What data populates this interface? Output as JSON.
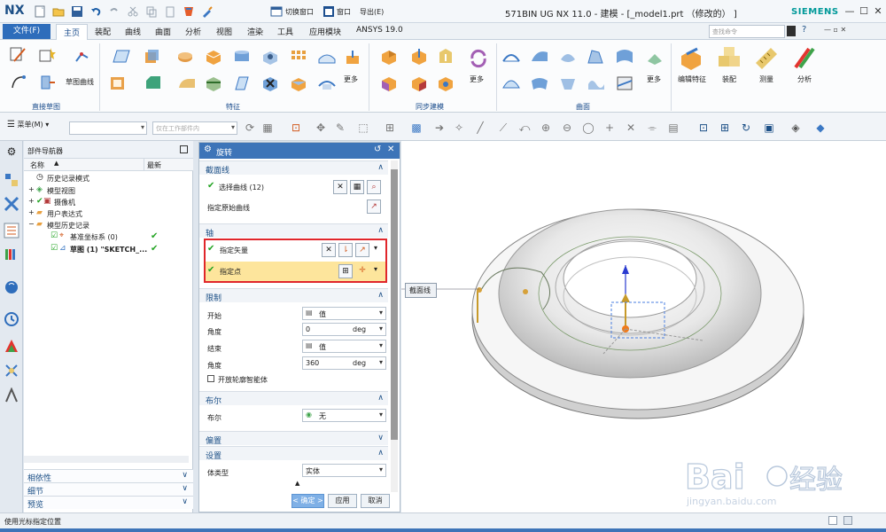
{
  "app": {
    "logo": "NX",
    "title": "571BIN UG NX 11.0 - 建模 - [_model1.prt （修改的） ]",
    "brand": "SIEMENS",
    "window_menu": "窗口",
    "switch_window": "切换窗口",
    "export": "导出(E)",
    "search_placeholder": "查找命令"
  },
  "ribbon": {
    "file_tab": "文件(F)",
    "tabs": [
      "主页",
      "装配",
      "曲线",
      "曲面",
      "分析",
      "视图",
      "渲染",
      "工具",
      "应用模块",
      "ANSYS 19.0"
    ],
    "active_tab": "主页",
    "groups": {
      "direct_sketch": "直接草图",
      "sketch_curve": "草图曲线",
      "feature": "特征",
      "sync_modeling": "同步建模",
      "surface": "曲面",
      "more": "更多",
      "edit_feature": "编辑特征",
      "assembly": "装配",
      "measure": "测量",
      "analysis": "分析"
    }
  },
  "toolbar": {
    "menu": "菜单(M)",
    "filter_placeholder": "",
    "scope": "仅在工作部件内"
  },
  "navigator": {
    "title": "部件导航器",
    "col_name": "名称",
    "col_latest": "最新",
    "items": [
      {
        "label": "历史记录模式",
        "level": 0,
        "check": false
      },
      {
        "label": "模型视图",
        "level": 0,
        "check": false
      },
      {
        "label": "摄像机",
        "level": 0,
        "check": false
      },
      {
        "label": "用户表达式",
        "level": 0,
        "check": false
      },
      {
        "label": "模型历史记录",
        "level": 0,
        "check": false
      },
      {
        "label": "基准坐标系 (0)",
        "level": 1,
        "check": true
      },
      {
        "label": "草图 (1) \"SKETCH_...",
        "level": 1,
        "check": true
      }
    ],
    "bottom_panels": [
      "相依性",
      "细节",
      "预览"
    ]
  },
  "dialog": {
    "title": "旋转",
    "sections": {
      "section_curve": "截面线",
      "axis": "轴",
      "limits": "限制",
      "boolean": "布尔",
      "offset": "偏置",
      "settings": "设置"
    },
    "select_curve": "选择曲线 (12)",
    "specify_origin_curve": "指定原始曲线",
    "specify_vector": "指定矢量",
    "specify_point": "指定点",
    "start_label": "开始",
    "start_value": "值",
    "angle_label": "角度",
    "start_angle": "0",
    "angle_unit": "deg",
    "end_label": "结束",
    "end_value": "值",
    "end_angle": "360",
    "open_profile": "开放轮廓智能体",
    "boolean_label": "布尔",
    "boolean_value": "无",
    "body_type_label": "体类型",
    "body_type_value": "实体",
    "ok": "< 确定 >",
    "apply": "应用",
    "cancel": "取消"
  },
  "graphics": {
    "callout": "截面线"
  },
  "status": {
    "text": "使用光标指定位置"
  },
  "colors": {
    "accent": "#3d74b8",
    "highlight": "#fde59c",
    "alert": "#e0262b",
    "check": "#22a322"
  }
}
